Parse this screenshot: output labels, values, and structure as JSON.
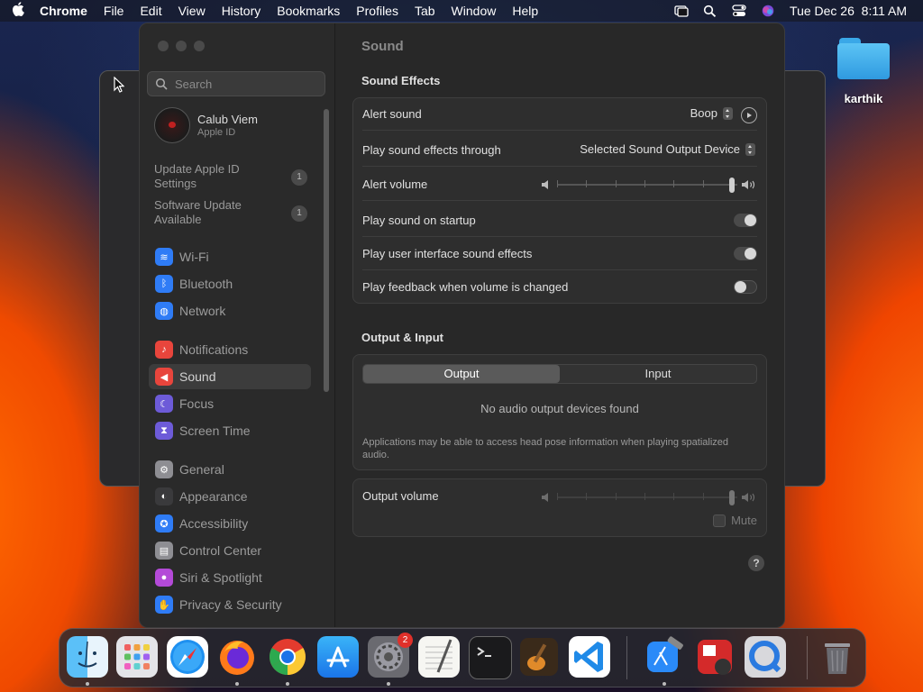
{
  "menubar": {
    "app": "Chrome",
    "items": [
      "File",
      "Edit",
      "View",
      "History",
      "Bookmarks",
      "Profiles",
      "Tab",
      "Window",
      "Help"
    ],
    "datetime": "Tue Dec 26  8:11 AM"
  },
  "desktop": {
    "folder_label": "karthik"
  },
  "sidebar": {
    "search_placeholder": "Search",
    "profile": {
      "name": "Calub Viem",
      "sub": "Apple ID"
    },
    "updates": [
      {
        "label": "Update Apple ID Settings",
        "count": "1"
      },
      {
        "label": "Software Update Available",
        "count": "1"
      }
    ],
    "items": [
      {
        "label": "Wi-Fi",
        "icon": "wifi-icon",
        "color": "#2f7cf6"
      },
      {
        "label": "Bluetooth",
        "icon": "bluetooth-icon",
        "color": "#2f7cf6"
      },
      {
        "label": "Network",
        "icon": "globe-icon",
        "color": "#2f7cf6"
      },
      {
        "label": "Notifications",
        "icon": "bell-icon",
        "color": "#e8453c"
      },
      {
        "label": "Sound",
        "icon": "speaker-icon",
        "color": "#e8453c"
      },
      {
        "label": "Focus",
        "icon": "moon-icon",
        "color": "#6d5bd8"
      },
      {
        "label": "Screen Time",
        "icon": "hourglass-icon",
        "color": "#6d5bd8"
      },
      {
        "label": "General",
        "icon": "gear-icon",
        "color": "#8e8e93"
      },
      {
        "label": "Appearance",
        "icon": "appearance-icon",
        "color": "#3a3a3c"
      },
      {
        "label": "Accessibility",
        "icon": "accessibility-icon",
        "color": "#2f7cf6"
      },
      {
        "label": "Control Center",
        "icon": "control-center-icon",
        "color": "#8e8e93"
      },
      {
        "label": "Siri & Spotlight",
        "icon": "siri-icon",
        "color": "#b44ad8"
      },
      {
        "label": "Privacy & Security",
        "icon": "hand-icon",
        "color": "#2f7cf6"
      }
    ]
  },
  "main": {
    "title": "Sound",
    "effects_heading": "Sound Effects",
    "alert_sound_label": "Alert sound",
    "alert_sound_value": "Boop",
    "play_through_label": "Play sound effects through",
    "play_through_value": "Selected Sound Output Device",
    "alert_volume_label": "Alert volume",
    "alert_volume_level": 1.0,
    "startup_label": "Play sound on startup",
    "startup_on": true,
    "ui_effects_label": "Play user interface sound effects",
    "ui_effects_on": true,
    "feedback_label": "Play feedback when volume is changed",
    "feedback_on": false,
    "io_heading": "Output & Input",
    "tab_output": "Output",
    "tab_input": "Input",
    "no_devices": "No audio output devices found",
    "head_pose_note": "Applications may be able to access head pose information when playing spatialized audio.",
    "output_volume_label": "Output volume",
    "output_volume_level": 1.0,
    "mute_label": "Mute",
    "help": "?"
  },
  "dock": {
    "apps": [
      "Finder",
      "Launchpad",
      "Safari",
      "Firefox",
      "Google Chrome",
      "App Store",
      "System Settings",
      "TextEdit",
      "Terminal",
      "GarageBand",
      "Visual Studio Code",
      "Xcode",
      "Photo Booth",
      "QuickTime Player",
      "Trash"
    ],
    "settings_badge": "2"
  }
}
